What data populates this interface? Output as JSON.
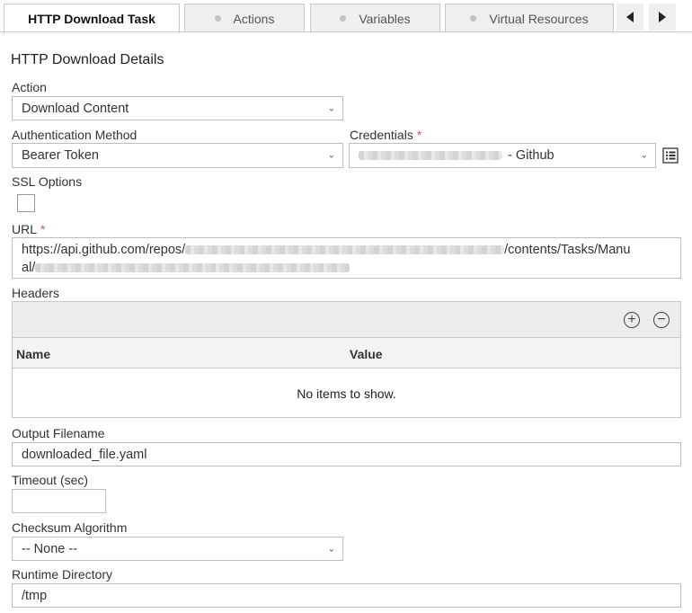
{
  "tabs": [
    {
      "label": "HTTP Download Task",
      "active": true
    },
    {
      "label": "Actions",
      "active": false
    },
    {
      "label": "Variables",
      "active": false
    },
    {
      "label": "Virtual Resources",
      "active": false
    }
  ],
  "section_title": "HTTP Download Details",
  "action": {
    "label": "Action",
    "value": "Download Content"
  },
  "auth_method": {
    "label": "Authentication Method",
    "value": "Bearer Token"
  },
  "credentials": {
    "label": "Credentials",
    "required_mark": "*",
    "value_suffix": "- Github"
  },
  "ssl": {
    "label": "SSL Options",
    "checked": false
  },
  "url": {
    "label": "URL",
    "required_mark": "*",
    "prefix": "https://api.github.com/repos/",
    "middle": "/contents/Tasks/Manu",
    "line2_prefix": "al/"
  },
  "headers": {
    "label": "Headers",
    "columns": [
      "Name",
      "Value"
    ],
    "empty_text": "No items to show."
  },
  "output_filename": {
    "label": "Output Filename",
    "value": "downloaded_file.yaml"
  },
  "timeout": {
    "label": "Timeout (sec)",
    "value": ""
  },
  "checksum": {
    "label": "Checksum Algorithm",
    "value": "-- None --"
  },
  "runtime_dir": {
    "label": "Runtime Directory",
    "value": "/tmp"
  },
  "colors": {
    "required": "#d9534f",
    "border": "#bdbdbd",
    "tab_bg": "#efefef"
  }
}
